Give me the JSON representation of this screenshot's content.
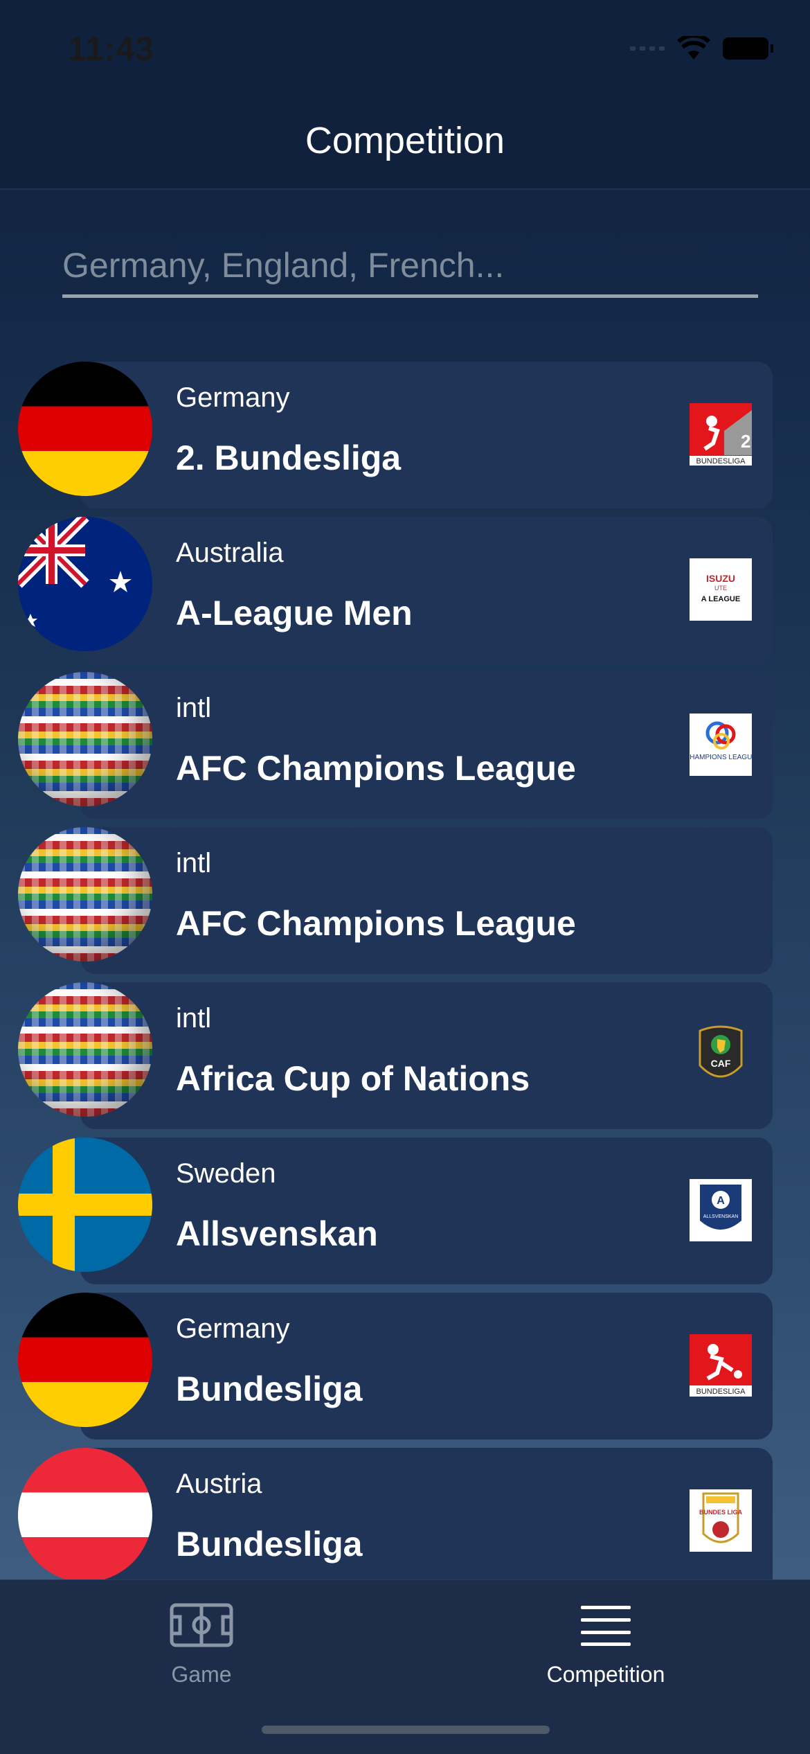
{
  "status_bar": {
    "time": "11:43"
  },
  "header": {
    "title": "Competition"
  },
  "search": {
    "placeholder": "Germany, England, French..."
  },
  "competitions": [
    {
      "country": "Germany",
      "league": "2. Bundesliga",
      "flag": "germany-flag",
      "logo": "2-bundesliga-logo",
      "logo_text": "BUNDESLIGA"
    },
    {
      "country": "Australia",
      "league": "A-League Men",
      "flag": "australia-flag",
      "logo": "a-league-logo",
      "logo_text": "A LEAGUE"
    },
    {
      "country": "intl",
      "league": "AFC Champions League",
      "flag": "world-globe-flag",
      "logo": "afc-champions-league-logo",
      "logo_text": "CHAMPIONS LEAGUE"
    },
    {
      "country": "intl",
      "league": "AFC Champions League",
      "flag": "world-globe-flag",
      "logo": ""
    },
    {
      "country": "intl",
      "league": "Africa Cup of Nations",
      "flag": "world-globe-flag",
      "logo": "africa-cup-of-nations-logo",
      "logo_text": "CAF"
    },
    {
      "country": "Sweden",
      "league": "Allsvenskan",
      "flag": "sweden-flag",
      "logo": "allsvenskan-logo",
      "logo_text": "ALLSVENSKAN"
    },
    {
      "country": "Germany",
      "league": "Bundesliga",
      "flag": "germany-flag",
      "logo": "bundesliga-logo",
      "logo_text": "BUNDESLIGA"
    },
    {
      "country": "Austria",
      "league": "Bundesliga",
      "flag": "austria-flag",
      "logo": "austrian-bundesliga-logo",
      "logo_text": "BUNDES LIGA"
    }
  ],
  "tabbar": {
    "items": [
      {
        "label": "Game",
        "icon": "soccer-field-icon",
        "active": false
      },
      {
        "label": "Competition",
        "icon": "list-menu-icon",
        "active": true
      }
    ],
    "active_color": "#ffffff",
    "inactive_color": "#8b97a6"
  }
}
